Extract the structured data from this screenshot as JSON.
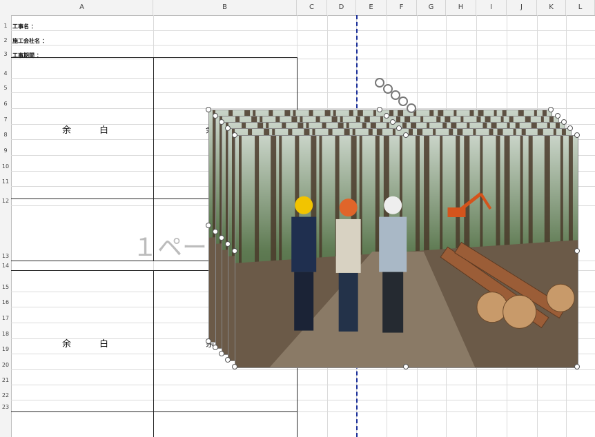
{
  "columns": [
    "A",
    "B",
    "C",
    "D",
    "E",
    "F",
    "G",
    "H",
    "I",
    "J",
    "K",
    "L"
  ],
  "rows": [
    "1",
    "2",
    "3",
    "4",
    "5",
    "6",
    "7",
    "8",
    "9",
    "10",
    "11",
    "12",
    "13",
    "14",
    "15",
    "16",
    "17",
    "18",
    "19",
    "20",
    "21",
    "22",
    "23"
  ],
  "header_cells": {
    "row1": "工事名 ：",
    "row2": "施工会社名 ：",
    "row3": "工事期間 ："
  },
  "blank_cells": {
    "top_left": "余　白",
    "top_right": "余",
    "bottom_left": "余　白",
    "bottom_right": "余"
  },
  "page_watermark": "１ペー",
  "photo": {
    "subject": "forestry workers with hard hats beside cut logs",
    "stack_count": 5
  },
  "colors": {
    "page_break": "#1a2f9a",
    "grid": "#dadada"
  }
}
